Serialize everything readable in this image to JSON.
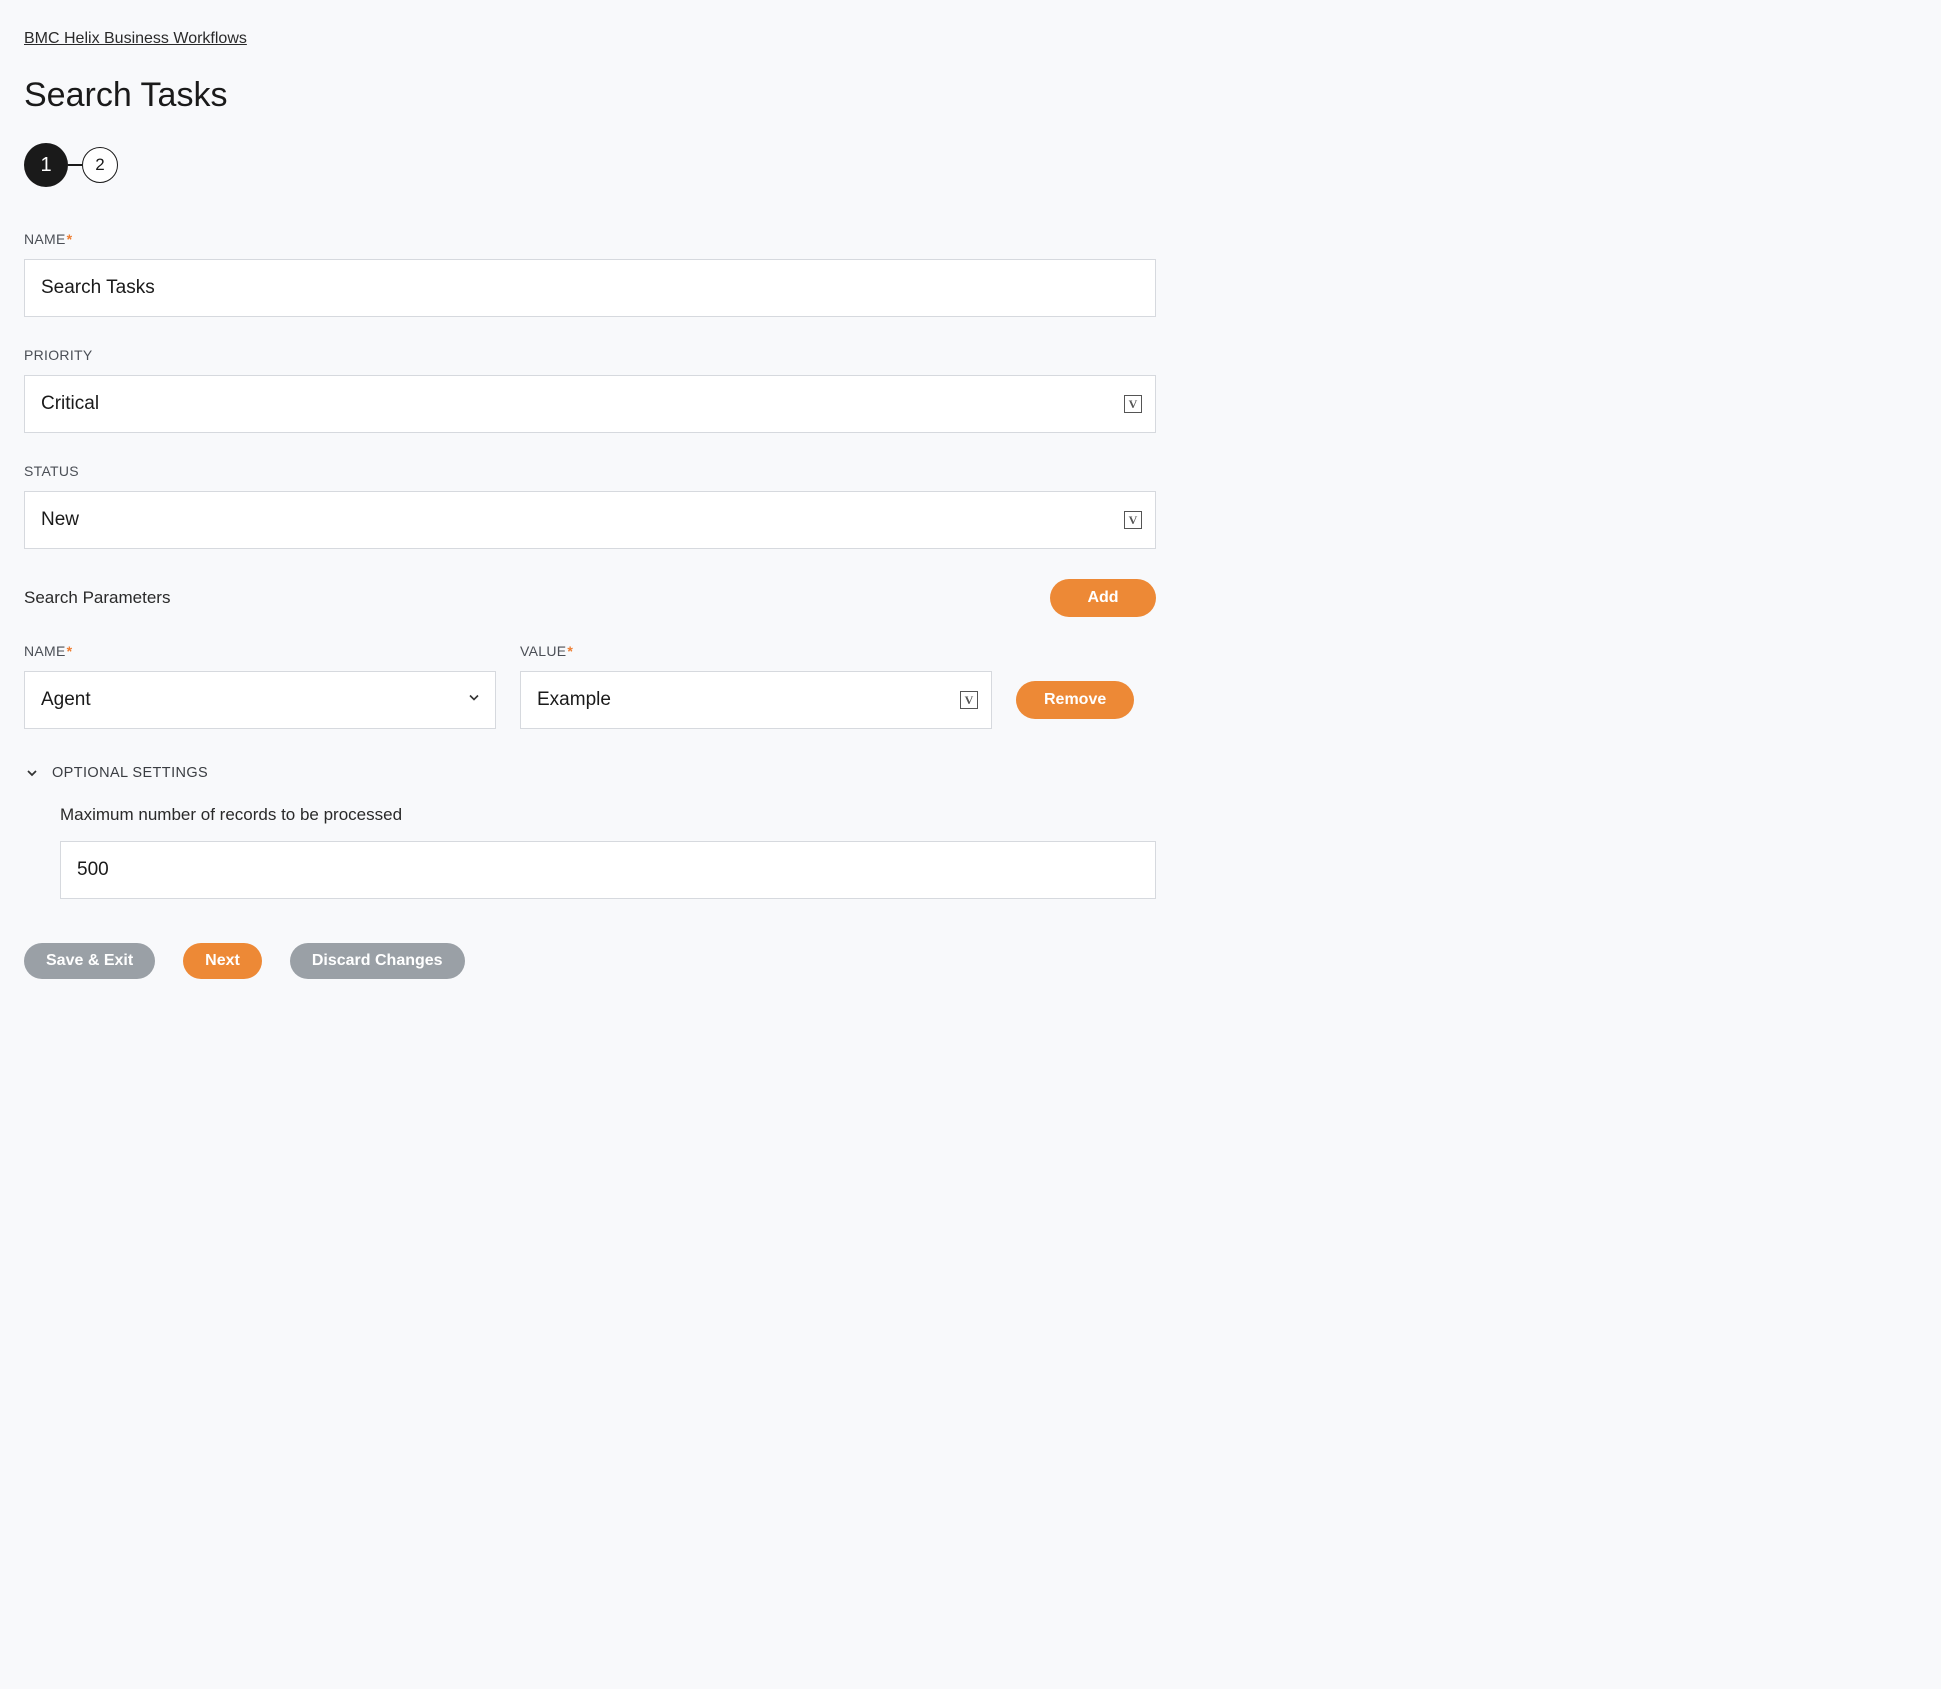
{
  "breadcrumb": "BMC Helix Business Workflows",
  "page_title": "Search Tasks",
  "stepper": {
    "steps": [
      "1",
      "2"
    ],
    "active": 0
  },
  "fields": {
    "name": {
      "label": "NAME",
      "value": "Search Tasks",
      "required": true
    },
    "priority": {
      "label": "PRIORITY",
      "value": "Critical",
      "required": false
    },
    "status": {
      "label": "STATUS",
      "value": "New",
      "required": false
    }
  },
  "search_params": {
    "header": "Search Parameters",
    "add_label": "Add",
    "remove_label": "Remove",
    "columns": {
      "name": "NAME",
      "value": "VALUE"
    },
    "rows": [
      {
        "name": "Agent",
        "value": "Example"
      }
    ]
  },
  "optional": {
    "header": "OPTIONAL SETTINGS",
    "max_records": {
      "label": "Maximum number of records to be processed",
      "value": "500"
    }
  },
  "footer": {
    "save_exit": "Save & Exit",
    "next": "Next",
    "discard": "Discard Changes"
  },
  "icons": {
    "variable": "V"
  }
}
